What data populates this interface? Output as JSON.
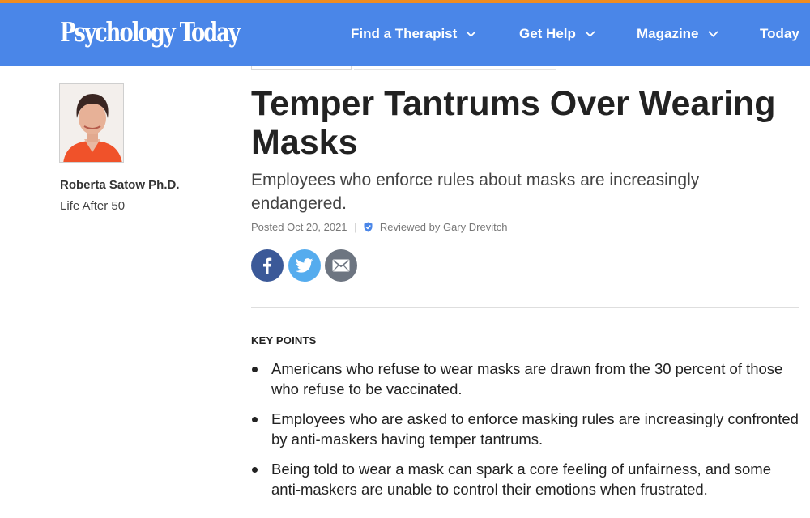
{
  "header": {
    "logo": "Psychology Today",
    "nav": [
      {
        "label": "Find a Therapist",
        "has_dropdown": true
      },
      {
        "label": "Get Help",
        "has_dropdown": true
      },
      {
        "label": "Magazine",
        "has_dropdown": true
      },
      {
        "label": "Today",
        "has_dropdown": false
      }
    ]
  },
  "author": {
    "name": "Roberta Satow Ph.D.",
    "blog": "Life After 50"
  },
  "article": {
    "title": "Temper Tantrums Over Wearing Masks",
    "subtitle": "Employees who enforce rules about masks are increasingly endangered.",
    "posted": "Posted Oct 20, 2021",
    "separator": "|",
    "reviewed_by": "Reviewed by Gary Drevitch"
  },
  "share": [
    {
      "network": "facebook",
      "icon": "facebook-icon"
    },
    {
      "network": "twitter",
      "icon": "twitter-icon"
    },
    {
      "network": "email",
      "icon": "email-icon"
    }
  ],
  "key_points": {
    "heading": "KEY POINTS",
    "items": [
      "Americans who refuse to wear masks are drawn from the 30 percent of those who refuse to be vaccinated.",
      "Employees who are asked to enforce masking rules are increasingly confronted by anti-maskers having temper tantrums.",
      "Being told to wear a mask can spark a core feeling of unfairness, and some anti-maskers are unable to control their emotions when frustrated."
    ]
  },
  "colors": {
    "header_bg": "#4a86e8",
    "top_accent": "#f08c1f",
    "facebook": "#3b5998",
    "twitter": "#55acee",
    "email": "#6d7581",
    "review_shield": "#4a86e8"
  }
}
